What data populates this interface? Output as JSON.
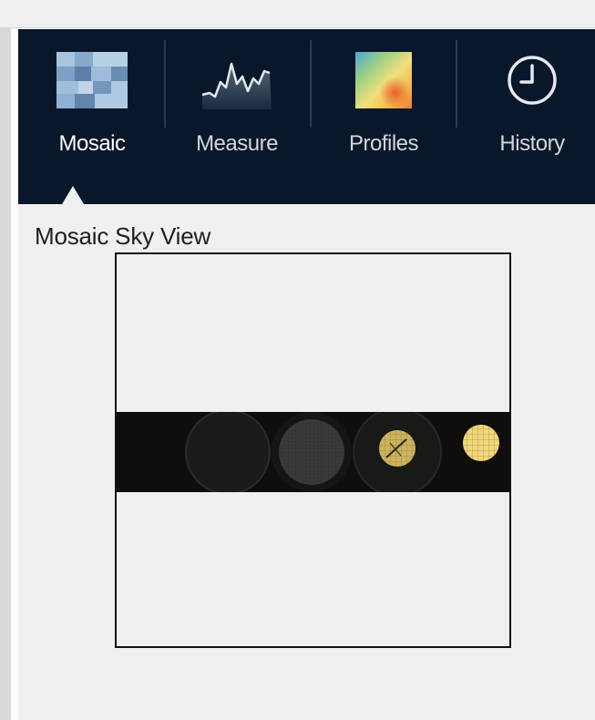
{
  "tabs": [
    {
      "label": "Mosaic",
      "icon": "mosaic-icon",
      "active": true
    },
    {
      "label": "Measure",
      "icon": "measure-chart-icon",
      "active": false
    },
    {
      "label": "Profiles",
      "icon": "profiles-heatmap-icon",
      "active": false
    },
    {
      "label": "History",
      "icon": "clock-icon",
      "active": false
    }
  ],
  "panel": {
    "title": "Mosaic Sky View"
  },
  "colors": {
    "ribbon_bg": "#08172a",
    "content_bg": "#f0f0f2",
    "sample_bright": "#f2d77a",
    "sample_mid": "#cdb35e"
  }
}
